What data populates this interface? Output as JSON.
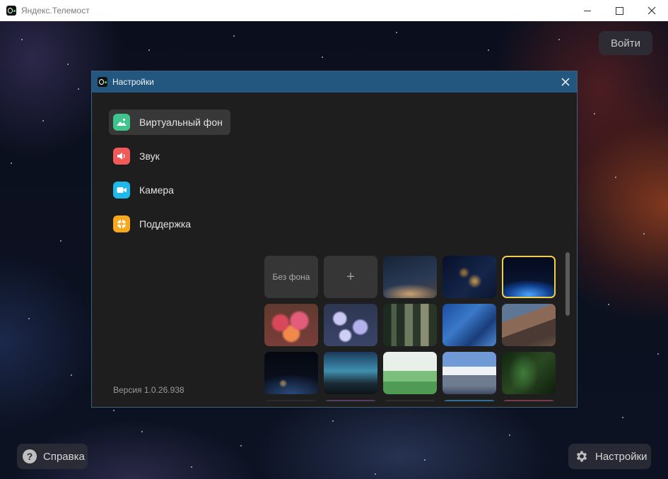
{
  "window": {
    "title": "Яндекс.Телемост"
  },
  "main": {
    "login_label": "Войти",
    "help_label": "Справка",
    "settings_label": "Настройки"
  },
  "dialog": {
    "title": "Настройки",
    "menu": [
      {
        "label": "Виртуальный фон",
        "icon": "image-icon",
        "color": "#3ec48c",
        "active": true
      },
      {
        "label": "Звук",
        "icon": "speaker-icon",
        "color": "#f25a5a",
        "active": false
      },
      {
        "label": "Камера",
        "icon": "camera-icon",
        "color": "#1fb8ea",
        "active": false
      },
      {
        "label": "Поддержка",
        "icon": "lifebuoy-icon",
        "color": "#f7a81c",
        "active": false
      }
    ],
    "version": "Версия 1.0.26.938",
    "backgrounds": {
      "no_background_label": "Без фона",
      "add_label": "+",
      "selected_index": 4,
      "items": [
        "no-background",
        "add-background",
        "night-sky",
        "city-lights-earth",
        "earth-horizon",
        "tulips",
        "asters",
        "forest",
        "ocean-waves",
        "mountain-ridge",
        "earth-night",
        "milky-way-lake",
        "green-hills",
        "snowy-mountains",
        "fern"
      ]
    }
  },
  "colors": {
    "accent_titlebar": "#24577f",
    "selection_border": "#f0d04a",
    "dialog_bg": "#1e1e1e"
  }
}
